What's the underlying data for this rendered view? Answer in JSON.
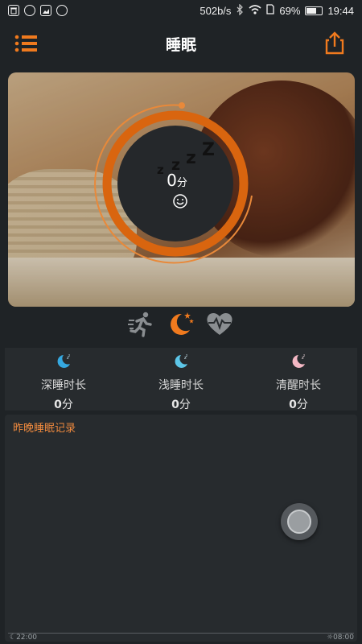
{
  "status_bar": {
    "network_speed": "502b/s",
    "battery_percent": "69%",
    "battery_level": 0.69,
    "time": "19:44",
    "left_icons": [
      "trash-icon",
      "wechat-icon",
      "image-icon",
      "smiley-icon"
    ],
    "right_icons": [
      "bluetooth-icon",
      "wifi-icon",
      "sim-icon",
      "battery-icon"
    ]
  },
  "header": {
    "title": "睡眠",
    "menu_icon": "list-menu-icon",
    "share_icon": "share-upload-icon"
  },
  "hero": {
    "value": "0",
    "unit": "分",
    "zzz": [
      "z",
      "z",
      "z",
      "Z"
    ],
    "mood_icon": "smiley-face-icon",
    "ring_progress": 0.0
  },
  "modes": {
    "items": [
      {
        "name": "running",
        "icon": "running-person-icon",
        "active": false
      },
      {
        "name": "sleep",
        "icon": "moon-stars-icon",
        "active": true
      },
      {
        "name": "heart",
        "icon": "heart-rate-icon",
        "active": false
      }
    ]
  },
  "stats": [
    {
      "label": "深睡时长",
      "value": "0",
      "unit": "分",
      "icon": "moon-icon",
      "color": "#35a8e0"
    },
    {
      "label": "浅睡时长",
      "value": "0",
      "unit": "分",
      "icon": "moon-icon",
      "color": "#5cc6e8"
    },
    {
      "label": "清醒时长",
      "value": "0",
      "unit": "分",
      "icon": "moon-icon",
      "color": "#f4b8c4"
    }
  ],
  "record": {
    "title": "昨晚睡眠记录",
    "start_time": "22:00",
    "end_time": "08:00"
  },
  "colors": {
    "accent": "#f08a3e",
    "ring": "#d9650f",
    "background": "#1f2326",
    "panel": "#272b2e"
  }
}
